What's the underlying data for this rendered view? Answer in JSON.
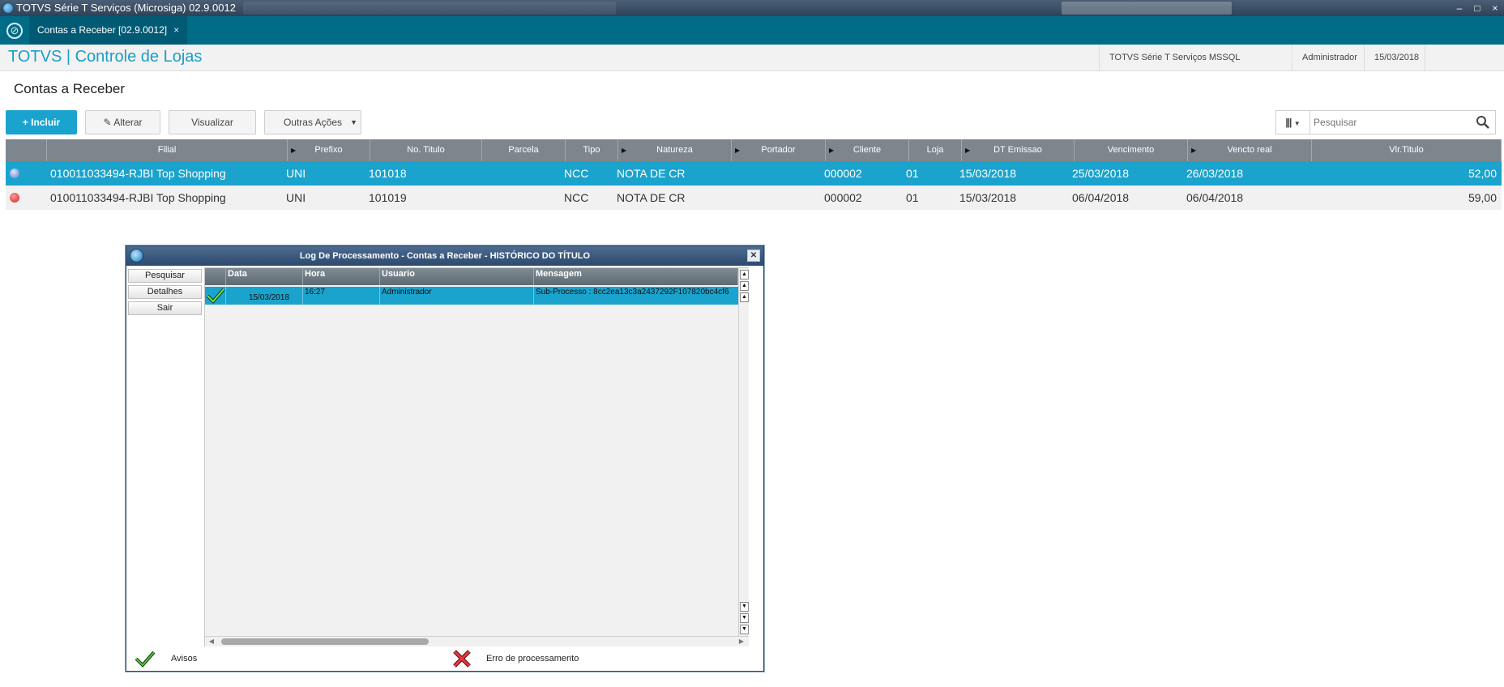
{
  "window": {
    "title": "TOTVS Série T Serviços (Microsiga) 02.9.0012",
    "minimize": "–",
    "maximize": "□",
    "close": "×"
  },
  "tabbar": {
    "tab_label": "Contas a Receber [02.9.0012]",
    "tab_close": "×"
  },
  "header": {
    "brand": "TOTVS | Controle de Lojas",
    "environment": "TOTVS Série T Serviços MSSQL",
    "user": "Administrador",
    "date": "15/03/2018"
  },
  "page": {
    "title": "Contas a Receber"
  },
  "toolbar": {
    "incluir": "Incluir",
    "alterar": "Alterar",
    "visualizar": "Visualizar",
    "outras_acoes": "Outras Ações",
    "search_placeholder": "Pesquisar"
  },
  "grid": {
    "columns": [
      "Filial",
      "Prefixo",
      "No. Titulo",
      "Parcela",
      "Tipo",
      "Natureza",
      "Portador",
      "Cliente",
      "Loja",
      "DT Emissao",
      "Vencimento",
      "Vencto real",
      "Vlr.Titulo"
    ],
    "rows": [
      {
        "status": "blue",
        "filial": "010011033494-RJBI Top Shopping",
        "prefixo": "UNI",
        "titulo": "101018",
        "parcela": "",
        "tipo": "NCC",
        "natureza": "NOTA DE CR",
        "portador": "",
        "cliente": "000002",
        "loja": "01",
        "emissao": "15/03/2018",
        "vencimento": "25/03/2018",
        "vencto_real": "26/03/2018",
        "valor": "52,00"
      },
      {
        "status": "red",
        "filial": "010011033494-RJBI Top Shopping",
        "prefixo": "UNI",
        "titulo": "101019",
        "parcela": "",
        "tipo": "NCC",
        "natureza": "NOTA DE CR",
        "portador": "",
        "cliente": "000002",
        "loja": "01",
        "emissao": "15/03/2018",
        "vencimento": "06/04/2018",
        "vencto_real": "06/04/2018",
        "valor": "59,00"
      }
    ]
  },
  "dialog": {
    "title": "Log De Processamento - Contas a Receber - HISTÓRICO DO TÍTULO",
    "buttons": {
      "pesquisar": "Pesquisar",
      "detalhes": "Detalhes",
      "sair": "Sair"
    },
    "log_columns": [
      "Data",
      "Hora",
      "Usuario",
      "Mensagem"
    ],
    "log_rows": [
      {
        "data": "15/03/2018",
        "hora": "16:27",
        "usuario": "Administrador",
        "mensagem": "Sub-Processo : 8cc2ea13c3a2437292F107820bc4cf6"
      }
    ],
    "legend": {
      "avisos": "Avisos",
      "erro": "Erro de processamento"
    }
  },
  "colors": {
    "tabbar": "#006c88",
    "brand": "#1a9ec9",
    "selection": "#1aa3cd",
    "primary_button": "#1ba3d0",
    "status_blue": "#5b7fc4",
    "status_red": "#d62020",
    "check_green": "#3cb521",
    "error_red": "#c8161d"
  }
}
